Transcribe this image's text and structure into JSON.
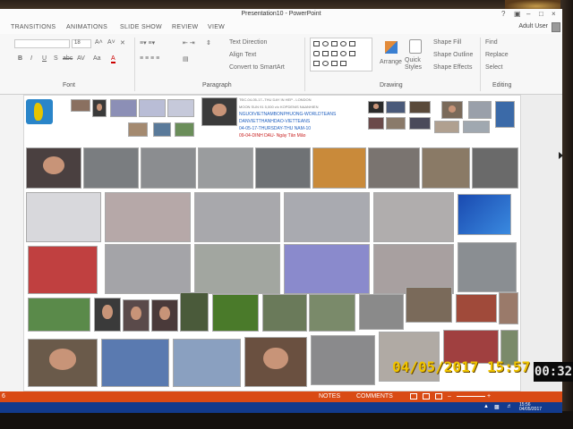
{
  "window": {
    "title": "Presentation10 - PowerPoint",
    "help": "?",
    "controls": [
      "–",
      "□",
      "×"
    ]
  },
  "ribbon_tabs": [
    "TRANSITIONS",
    "ANIMATIONS",
    "SLIDE SHOW",
    "REVIEW",
    "VIEW"
  ],
  "user": "Adult User",
  "ribbon": {
    "font": {
      "size": "18",
      "grow": "A˄",
      "shrink": "A˅",
      "clear": "✕",
      "buttons": [
        "B",
        "I",
        "U",
        "S",
        "abc",
        "AV",
        "Aa",
        "A"
      ],
      "label": "Font"
    },
    "paragraph": {
      "text_direction": "Text Direction",
      "align_text": "Align Text",
      "convert": "Convert to SmartArt",
      "label": "Paragraph"
    },
    "drawing": {
      "arrange": "Arrange",
      "quick_styles": "Quick Styles",
      "shape_fill": "Shape Fill",
      "shape_outline": "Shape Outline",
      "shape_effects": "Shape Effects",
      "label": "Drawing"
    },
    "editing": {
      "find": "Find",
      "replace": "Replace",
      "select": "Select",
      "label": "Editing"
    }
  },
  "slide_text": {
    "line1": "TĐC-04-05-17--THU DAY IN HEP - LONDON",
    "line2": "MOON SUN 91 5,000 v/c KOPDENIS NAANHIEN",
    "line3": "NGUOIVIETNAMBONPHUONG-WORLDTEANS",
    "line4": "DANVIETTHANHDAO-VIETTEANS",
    "line5": "04-05-17-THURSDAY-THU NAM-10",
    "line6": "09-04-DINH DAU- Ngày Tân Mão"
  },
  "status": {
    "notes": "NOTES",
    "comments": "COMMENTS",
    "zoom_minus": "–",
    "zoom_plus": "+",
    "page": "6"
  },
  "tray": {
    "time": "15:56",
    "date": "04/05/2017"
  },
  "camera_stamp": {
    "datetime": "04/05/2017  15:57",
    "seconds": "00:32"
  },
  "colors": {
    "status_orange": "#d94a14",
    "taskbar_blue": "#123a8c",
    "stamp_yellow": "#f0c400"
  }
}
